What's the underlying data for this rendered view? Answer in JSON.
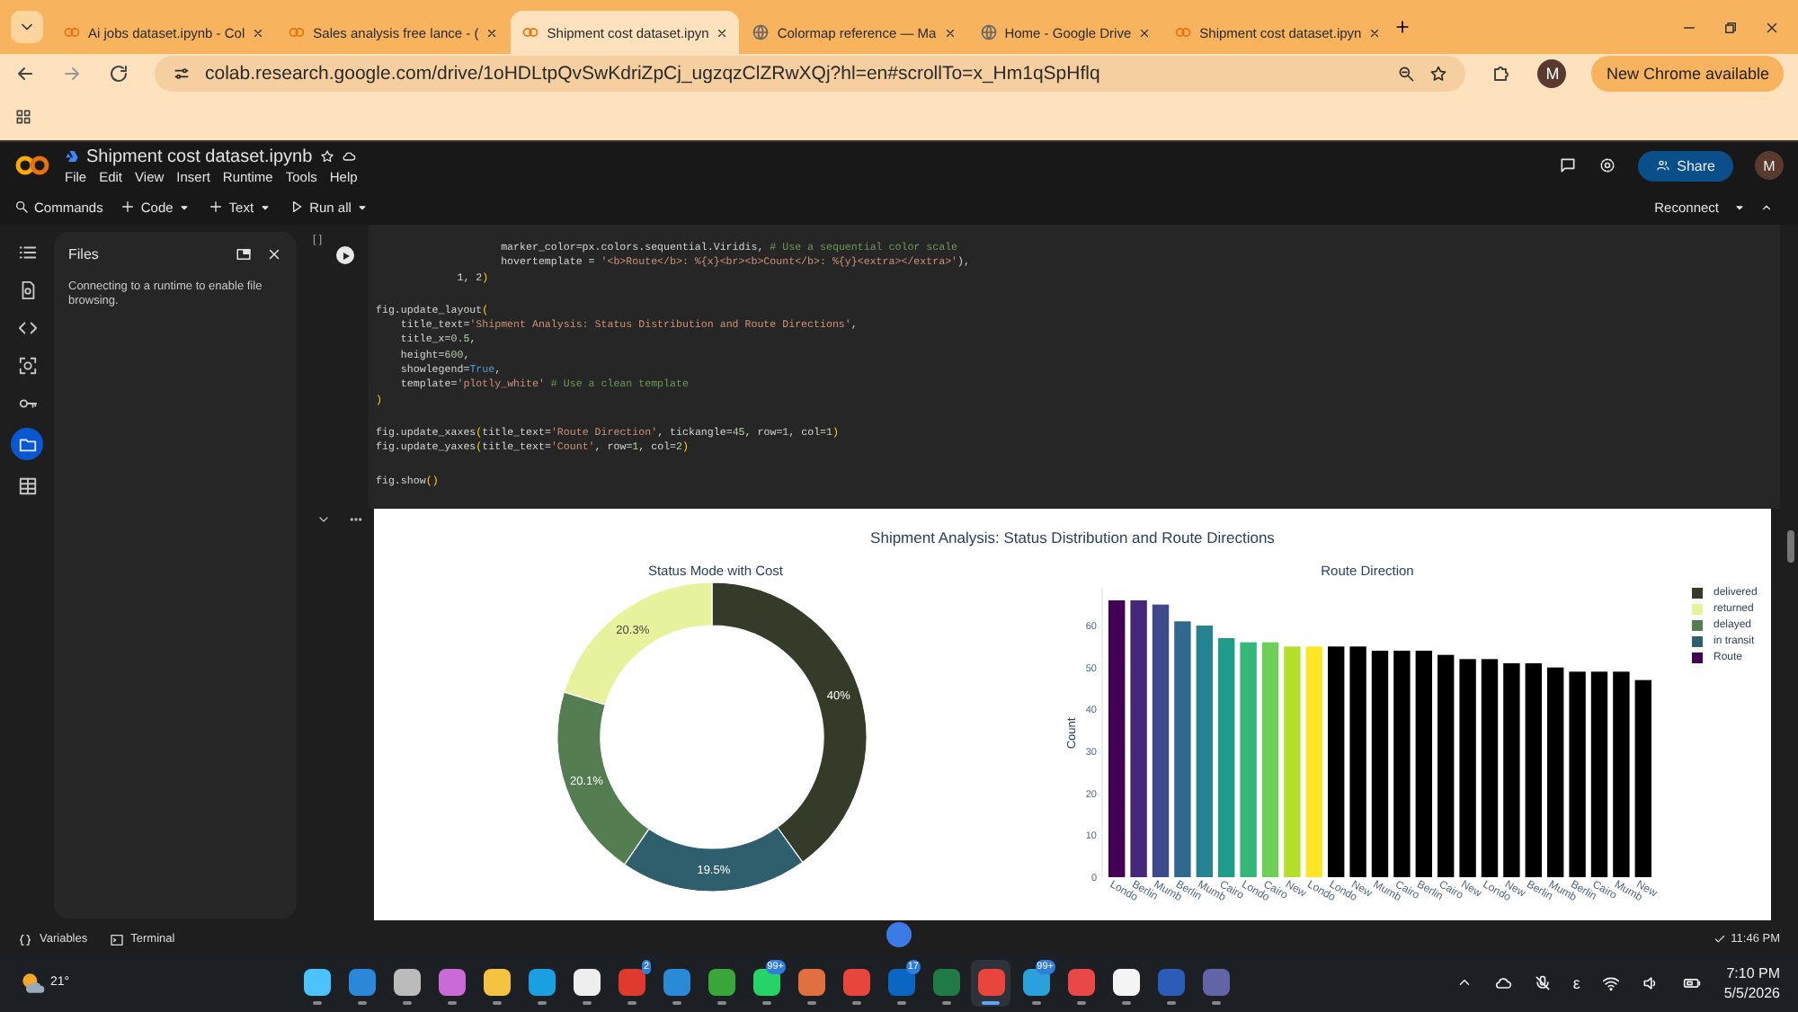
{
  "browser": {
    "tabs": [
      {
        "title": "Ai jobs dataset.ipynb - Col",
        "selected": false,
        "kind": "notebook"
      },
      {
        "title": "Sales analysis free lance - (",
        "selected": false,
        "kind": "notebook"
      },
      {
        "title": "Shipment cost dataset.ipyn",
        "selected": true,
        "kind": "notebook"
      },
      {
        "title": "Colormap reference — Ma",
        "selected": false,
        "kind": "web"
      },
      {
        "title": "Home - Google Drive",
        "selected": false,
        "kind": "web"
      },
      {
        "title": "Shipment cost dataset.ipyn",
        "selected": false,
        "kind": "notebook"
      }
    ],
    "url": "colab.research.google.com/drive/1oHDLtpQvSwKdriZpCj_ugzqzClZRwXQj?hl=en#scrollTo=x_Hm1qSpHflq",
    "profile": "M",
    "update_button": "New Chrome available"
  },
  "colab": {
    "notebook_title": "Shipment cost dataset.ipynb",
    "menu": [
      "File",
      "Edit",
      "View",
      "Insert",
      "Runtime",
      "Tools",
      "Help"
    ],
    "share": "Share",
    "avatar": "M",
    "toolbar": [
      {
        "label": "Commands",
        "kind": "search"
      },
      {
        "label": "Code",
        "kind": "add"
      },
      {
        "label": "Text",
        "kind": "add"
      },
      {
        "label": "Run all",
        "kind": "run"
      }
    ],
    "reconnect": "Reconnect",
    "rail": [
      {
        "kind": "toc",
        "selected": false
      },
      {
        "kind": "find",
        "selected": false
      },
      {
        "kind": "code",
        "selected": false
      },
      {
        "kind": "vars",
        "selected": false
      },
      {
        "kind": "key",
        "selected": false
      },
      {
        "kind": "folder",
        "selected": true
      },
      {
        "kind": "table",
        "selected": false
      }
    ],
    "files_panel": {
      "title": "Files",
      "message": "Connecting to a runtime to enable file browsing."
    },
    "cell": {
      "execution_count": "[ ]",
      "blocks": [
        [
          [
            {
              "text": "                    marker_color=px.colors.sequential.Viridis, ",
              "kind": "plain"
            },
            {
              "text": "# Use a sequential color scale",
              "kind": "comment"
            }
          ],
          [
            {
              "text": "                    hovertemplate = ",
              "kind": "plain"
            },
            {
              "text": "'<b>Route</b>: %{x}<br><b>Count</b>: %{y}<extra></extra>'",
              "kind": "string"
            },
            {
              "text": "),",
              "kind": "plain"
            }
          ],
          [
            {
              "text": "             1, 2",
              "kind": "plain"
            },
            {
              "text": ")",
              "kind": "bracket"
            }
          ]
        ],
        [
          [
            {
              "text": "fig.update_layout",
              "kind": "plain"
            },
            {
              "text": "(",
              "kind": "bracket"
            }
          ],
          [
            {
              "text": "    title_text=",
              "kind": "plain"
            },
            {
              "text": "'Shipment Analysis: Status Distribution and Route Directions'",
              "kind": "string"
            },
            {
              "text": ",",
              "kind": "plain"
            }
          ],
          [
            {
              "text": "    title_x=",
              "kind": "plain"
            },
            {
              "text": "0.5",
              "kind": "number"
            },
            {
              "text": ",",
              "kind": "plain"
            }
          ],
          [
            {
              "text": "    height=",
              "kind": "plain"
            },
            {
              "text": "600",
              "kind": "number"
            },
            {
              "text": ",",
              "kind": "plain"
            }
          ],
          [
            {
              "text": "    showlegend=",
              "kind": "plain"
            },
            {
              "text": "True",
              "kind": "keyword"
            },
            {
              "text": ",",
              "kind": "plain"
            }
          ],
          [
            {
              "text": "    template=",
              "kind": "plain"
            },
            {
              "text": "'plotly_white'",
              "kind": "string"
            },
            {
              "text": " # Use a clean template",
              "kind": "comment"
            }
          ],
          [
            {
              "text": ")",
              "kind": "bracket"
            }
          ]
        ],
        [
          [
            {
              "text": "fig.update_xaxes",
              "kind": "plain"
            },
            {
              "text": "(",
              "kind": "bracket"
            },
            {
              "text": "title_text=",
              "kind": "plain"
            },
            {
              "text": "'Route Direction'",
              "kind": "string"
            },
            {
              "text": ", tickangle=",
              "kind": "plain"
            },
            {
              "text": "45",
              "kind": "number"
            },
            {
              "text": ", row=",
              "kind": "plain"
            },
            {
              "text": "1",
              "kind": "number"
            },
            {
              "text": ", col=",
              "kind": "plain"
            },
            {
              "text": "1",
              "kind": "number"
            },
            {
              "text": ")",
              "kind": "bracket"
            }
          ],
          [
            {
              "text": "fig.update_yaxes",
              "kind": "plain"
            },
            {
              "text": "(",
              "kind": "bracket"
            },
            {
              "text": "title_text=",
              "kind": "plain"
            },
            {
              "text": "'Count'",
              "kind": "string"
            },
            {
              "text": ", row=",
              "kind": "plain"
            },
            {
              "text": "1",
              "kind": "number"
            },
            {
              "text": ", col=",
              "kind": "plain"
            },
            {
              "text": "2",
              "kind": "number"
            },
            {
              "text": ")",
              "kind": "bracket"
            }
          ]
        ],
        [
          [
            {
              "text": "fig.show",
              "kind": "plain"
            },
            {
              "text": "()",
              "kind": "bracket"
            }
          ]
        ]
      ]
    },
    "output": {
      "title": "Shipment Analysis: Status Distribution and Route Directions",
      "pie": {
        "chart_data": {
          "type": "donut",
          "title": "Status Mode with Cost",
          "categories": [
            "delivered",
            "returned",
            "delayed",
            "in transit"
          ],
          "values": [
            40,
            20.3,
            20.1,
            19.5
          ],
          "colors": [
            "#343b29",
            "#e8f29c",
            "#557d52",
            "#2f5f6d"
          ],
          "value_labels": [
            "40%",
            "20.3%",
            "20.1%",
            "19.5%"
          ]
        }
      },
      "bar": {
        "chart_data": {
          "type": "bar",
          "title": "Route Direction",
          "ylabel": "Count",
          "categories": [
            "Londo",
            "Berlin",
            "Mumb",
            "Berlin",
            "Mumb",
            "Cairo",
            "Londo",
            "Cairo",
            "New",
            "Londo",
            "Londo",
            "New",
            "Mumb",
            "Cairo",
            "Berlin",
            "Cairo",
            "New",
            "Londo",
            "New",
            "Berlin",
            "Mumb",
            "Berlin",
            "Cairo",
            "Mumb",
            "New"
          ],
          "series": [
            {
              "name": "Route",
              "color": "#440154",
              "values": [
                66,
                66,
                65,
                61,
                60,
                57,
                56,
                56,
                55,
                55,
                55,
                55,
                54,
                54,
                54,
                53,
                52,
                52,
                51,
                51,
                50,
                49,
                49,
                49,
                47
              ],
              "colors": [
                "#440154",
                "#46277a",
                "#3e4a89",
                "#31688e",
                "#26838f",
                "#1f9d8a",
                "#35b779",
                "#6ece58",
                "#b5de2b",
                "#fde725",
                "#000000",
                "#000000",
                "#000000",
                "#000000",
                "#000000",
                "#000000",
                "#000000",
                "#000000",
                "#000000",
                "#000000",
                "#000000",
                "#000000",
                "#000000",
                "#000000",
                "#000000"
              ]
            }
          ],
          "ylim": [
            0,
            69
          ],
          "yticks": [
            0,
            10,
            20,
            30,
            40,
            50,
            60
          ]
        }
      }
    },
    "status_bar": {
      "items": [
        "Variables",
        "Terminal"
      ],
      "time": "11:46 PM"
    }
  },
  "taskbar": {
    "weather": "21°",
    "apps": [
      {
        "color": "#4cc2ff",
        "selected": false
      },
      {
        "color": "#2b88d8",
        "selected": false
      },
      {
        "color": "#bbbbbb",
        "selected": false
      },
      {
        "color": "#c86bd6",
        "selected": false
      },
      {
        "color": "#f5c242",
        "selected": false
      },
      {
        "color": "#1a9fe0",
        "selected": false
      },
      {
        "color": "#eeeeee",
        "selected": false
      },
      {
        "color": "#e03a2e",
        "selected": false,
        "badge": "2"
      },
      {
        "color": "#2a8ad8",
        "selected": false
      },
      {
        "color": "#3aa63a",
        "selected": false
      },
      {
        "color": "#25d366",
        "selected": false,
        "badge": "99+"
      },
      {
        "color": "#e07040",
        "selected": false
      },
      {
        "color": "#e8453c",
        "selected": false
      },
      {
        "color": "#0a66c2",
        "selected": false,
        "badge": "17"
      },
      {
        "color": "#1f7a45",
        "selected": false
      },
      {
        "color": "#e8453c",
        "selected": true
      },
      {
        "color": "#2aa1da",
        "selected": false,
        "badge": "99+"
      },
      {
        "color": "#e84848",
        "selected": false
      },
      {
        "color": "#f4f4f4",
        "selected": false
      },
      {
        "color": "#2b5cb8",
        "selected": false
      },
      {
        "color": "#6264a7",
        "selected": false
      }
    ],
    "input_indicator": "ε",
    "time": "7:10 PM",
    "date": "5/5/2026"
  }
}
